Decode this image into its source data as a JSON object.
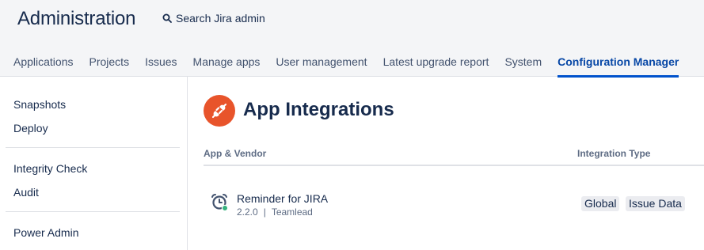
{
  "header": {
    "title": "Administration",
    "search_label": "Search Jira admin"
  },
  "tabs": [
    {
      "label": "Applications"
    },
    {
      "label": "Projects"
    },
    {
      "label": "Issues"
    },
    {
      "label": "Manage apps"
    },
    {
      "label": "User management"
    },
    {
      "label": "Latest upgrade report"
    },
    {
      "label": "System"
    },
    {
      "label": "Configuration Manager",
      "active": true
    }
  ],
  "sidebar": {
    "items": [
      {
        "label": "Snapshots"
      },
      {
        "label": "Deploy"
      },
      {
        "label": "Integrity Check"
      },
      {
        "label": "Audit"
      },
      {
        "label": "Power Admin"
      }
    ]
  },
  "main": {
    "title": "App Integrations",
    "icon": "plug-icon",
    "columns": {
      "app_vendor": "App & Vendor",
      "integration_type": "Integration Type"
    },
    "rows": [
      {
        "icon": "alarm-clock-icon",
        "name": "Reminder for JIRA",
        "version": "2.2.0",
        "separator": "|",
        "vendor": "Teamlead",
        "types": [
          "Global",
          "Issue Data"
        ]
      }
    ]
  },
  "colors": {
    "accent": "#0052cc",
    "brand_orange": "#e8542b",
    "status_green": "#36b37e"
  }
}
